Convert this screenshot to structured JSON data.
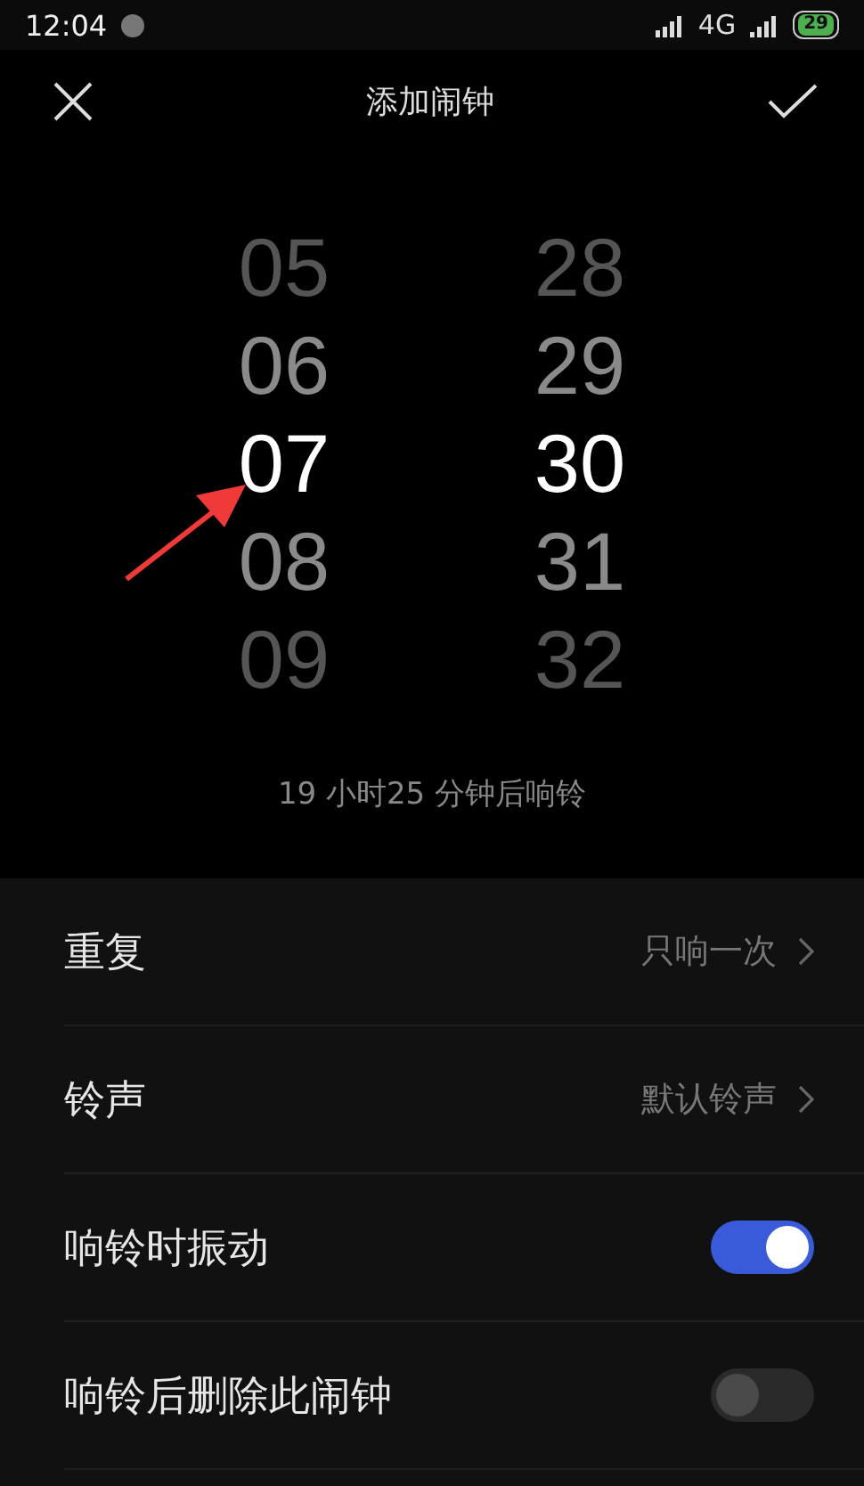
{
  "status_bar": {
    "time": "12:04",
    "network": "4G",
    "battery": "29"
  },
  "header": {
    "title": "添加闹钟"
  },
  "picker": {
    "hours": [
      {
        "label": "05",
        "selected": false
      },
      {
        "label": "06",
        "selected": false
      },
      {
        "label": "07",
        "selected": true
      },
      {
        "label": "08",
        "selected": false
      },
      {
        "label": "09",
        "selected": false
      }
    ],
    "minutes": [
      {
        "label": "28",
        "selected": false
      },
      {
        "label": "29",
        "selected": false
      },
      {
        "label": "30",
        "selected": true
      },
      {
        "label": "31",
        "selected": false
      },
      {
        "label": "32",
        "selected": false
      }
    ]
  },
  "countdown": "19 小时25 分钟后响铃",
  "settings": [
    {
      "kind": "link",
      "label": "重复",
      "value": "只响一次"
    },
    {
      "kind": "link",
      "label": "铃声",
      "value": "默认铃声"
    },
    {
      "kind": "toggle",
      "label": "响铃时振动",
      "on": true
    },
    {
      "kind": "toggle",
      "label": "响铃后删除此闹钟",
      "on": false
    }
  ]
}
